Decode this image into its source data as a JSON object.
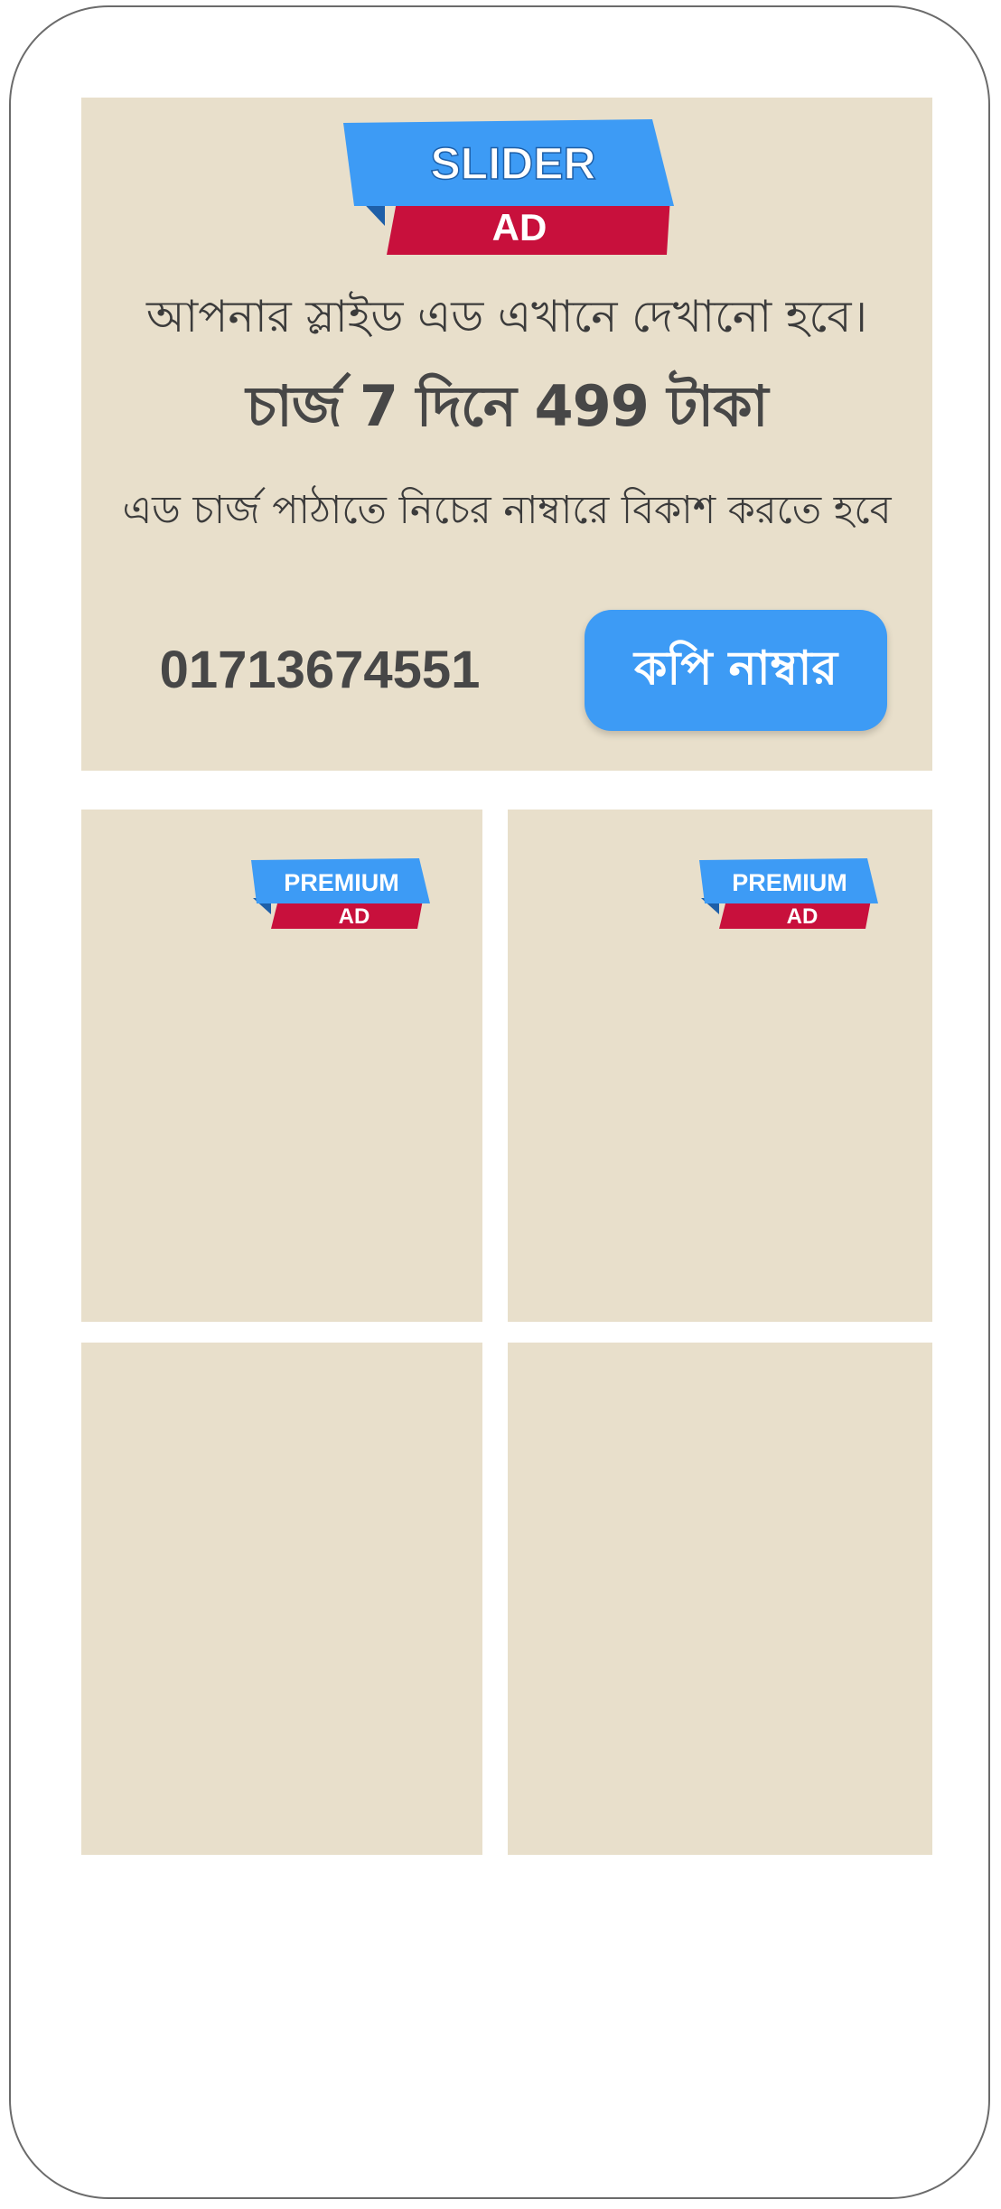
{
  "slider_ad": {
    "badge_top": "SLIDER",
    "badge_bottom": "AD",
    "line1": "আপনার স্লাইড এড এখানে দেখানো হবে।",
    "line2": "চার্জ 7 দিনে 499 টাকা",
    "line3": "এড চার্জ পাঠাতে নিচের নাম্বারে বিকাশ করতে হবে",
    "phone": "01713674551",
    "copy_button": "কপি নাম্বার"
  },
  "cards": [
    {
      "badge_top": "PREMIUM",
      "badge_bottom": "AD"
    },
    {
      "badge_top": "PREMIUM",
      "badge_bottom": "AD"
    },
    {},
    {}
  ],
  "colors": {
    "card_bg": "#e8dfcb",
    "badge_blue": "#3d9bf5",
    "badge_red": "#c8103c",
    "badge_dark_blue": "#1e5fa8",
    "text_dark": "#474747"
  }
}
